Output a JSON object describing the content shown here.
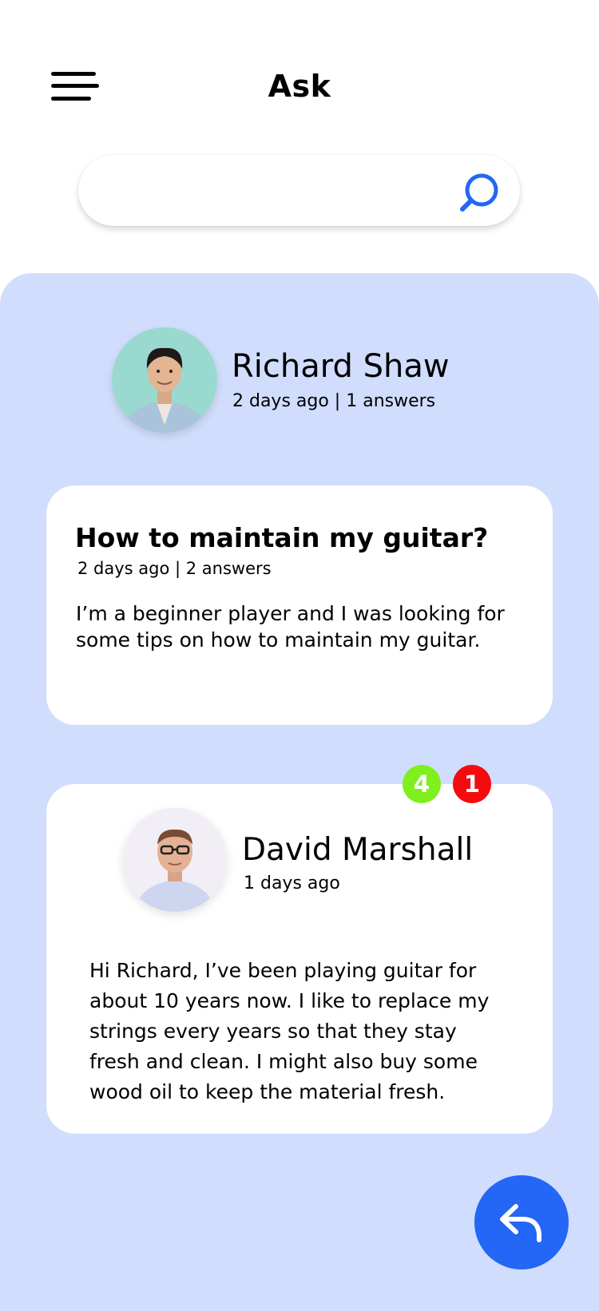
{
  "header": {
    "title": "Ask",
    "menu_icon": "hamburger-menu-icon"
  },
  "search": {
    "value": "",
    "placeholder": "",
    "icon": "search-icon",
    "accent": "#2466f5"
  },
  "theme": {
    "panel_background": "#d1ddfc",
    "card_background": "#ffffff",
    "primary": "#2466f5",
    "upvote_color": "#7ff01e",
    "downvote_color": "#f40b10"
  },
  "asker": {
    "name": "Richard Shaw",
    "meta": "2 days ago | 1 answers"
  },
  "question": {
    "title": "How to maintain my guitar?",
    "meta": "2 days ago | 2 answers",
    "body": "I’m a beginner player and I was looking for some tips on how to maintain my guitar."
  },
  "answer": {
    "upvotes": "4",
    "downvotes": "1",
    "author": "David Marshall",
    "meta": "1 days ago",
    "body": "Hi Richard, I’ve been playing guitar for about 10 years now. I like to replace my strings every years so that they stay fresh and clean. I might also buy some wood oil to keep the material fresh."
  },
  "reply_button": {
    "icon": "reply-arrow-icon"
  }
}
